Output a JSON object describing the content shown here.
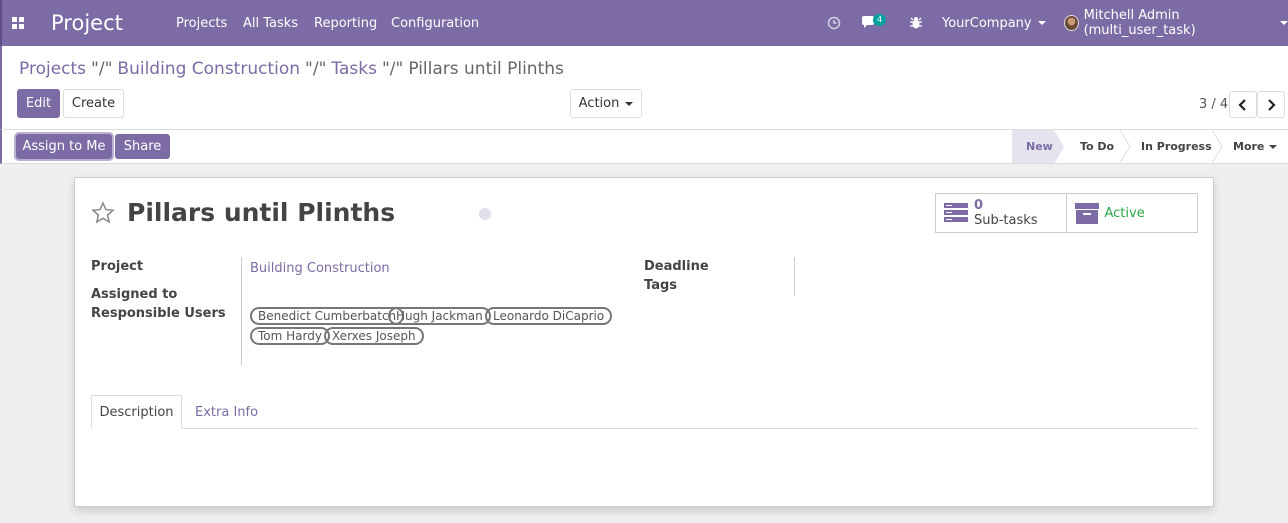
{
  "navbar": {
    "app_title": "Project",
    "menu": [
      "Projects",
      "All Tasks",
      "Reporting",
      "Configuration"
    ],
    "messages_badge": "4",
    "company": "YourCompany",
    "user": "Mitchell Admin (multi_user_task)"
  },
  "breadcrumb": {
    "items": [
      "Projects",
      "Building Construction",
      "Tasks"
    ],
    "separator": "\"/\"",
    "current": "Pillars until Plinths"
  },
  "toolbar": {
    "edit_label": "Edit",
    "create_label": "Create",
    "action_label": "Action",
    "pager": "3 / 4"
  },
  "statusbar": {
    "assign_label": "Assign to Me",
    "share_label": "Share",
    "stages": [
      "New",
      "To Do",
      "In Progress"
    ],
    "current_stage": "New",
    "more_label": "More"
  },
  "form": {
    "title": "Pillars until Plinths",
    "subtasks_count": "0",
    "subtasks_label": "Sub-tasks",
    "active_label": "Active",
    "labels": {
      "project": "Project",
      "assigned_to": "Assigned to",
      "responsible": "Responsible Users",
      "deadline": "Deadline",
      "tags": "Tags"
    },
    "project_value": "Building Construction",
    "responsible_users": [
      "Benedict Cumberbatch",
      "Hugh Jackman",
      "Leonardo DiCaprio",
      "Tom Hardy",
      "Xerxes Joseph"
    ],
    "tabs": [
      "Description",
      "Extra Info"
    ]
  },
  "colors": {
    "brand": "#7c6ba4",
    "active_green": "#28a745",
    "badge_teal": "#00a09d"
  },
  "icons": [
    "apps-icon",
    "clock-icon",
    "chat-icon",
    "bug-icon",
    "star-icon",
    "subtasks-icon",
    "archive-icon",
    "chevron-left-icon",
    "chevron-right-icon"
  ]
}
